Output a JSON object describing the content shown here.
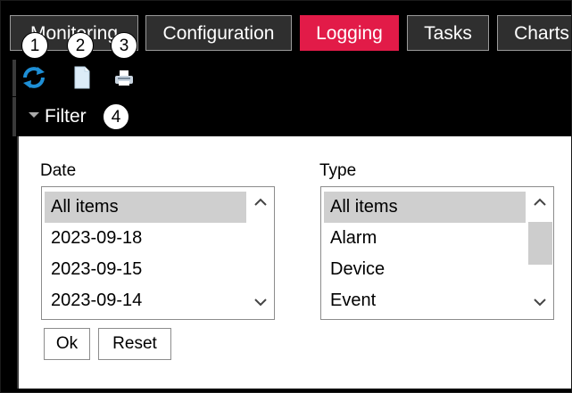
{
  "tabs": [
    {
      "label": "Monitoring",
      "active": false
    },
    {
      "label": "Configuration",
      "active": false
    },
    {
      "label": "Logging",
      "active": true
    },
    {
      "label": "Tasks",
      "active": false
    },
    {
      "label": "Charts",
      "active": false
    }
  ],
  "toolbar": {
    "icons": [
      "refresh-icon",
      "document-icon",
      "print-icon"
    ]
  },
  "filter": {
    "label": "Filter",
    "date": {
      "label": "Date",
      "items": [
        "All items",
        "2023-09-18",
        "2023-09-15",
        "2023-09-14"
      ],
      "selected": "All items"
    },
    "type": {
      "label": "Type",
      "items": [
        "All items",
        "Alarm",
        "Device",
        "Event"
      ],
      "selected": "All items"
    },
    "ok_label": "Ok",
    "reset_label": "Reset"
  },
  "callouts": [
    "1",
    "2",
    "3",
    "4"
  ],
  "colors": {
    "active_tab": "#e21b48",
    "tab": "#2f2f2f",
    "selection": "#cfcfcf",
    "refresh_icon": "#1e8fd6"
  }
}
